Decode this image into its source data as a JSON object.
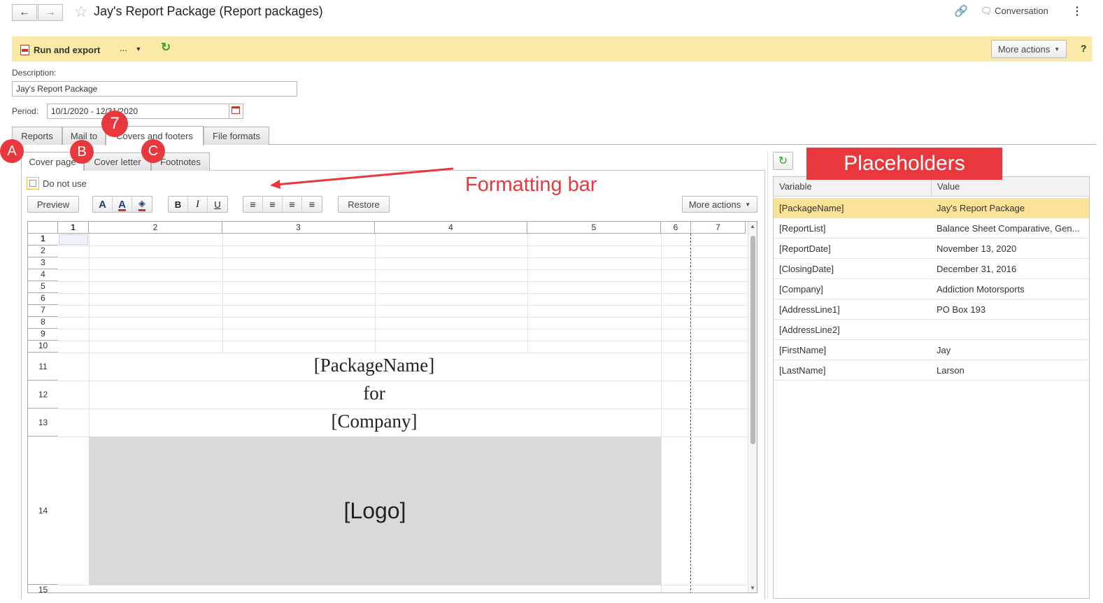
{
  "window": {
    "title": "Jay's Report Package (Report packages)",
    "conversation_label": "Conversation"
  },
  "command_bar": {
    "run_export_label": "Run and export",
    "dots_label": "...",
    "more_actions_label": "More actions",
    "help_label": "?"
  },
  "form": {
    "description_label": "Description:",
    "description_value": "Jay's Report Package",
    "period_label": "Period:",
    "period_value": "10/1/2020 - 12/31/2020"
  },
  "main_tabs": [
    "Reports",
    "Mail to",
    "Covers and footers",
    "File formats"
  ],
  "sub_tabs": [
    "Cover page",
    "Cover letter",
    "Footnotes"
  ],
  "editor": {
    "do_not_use_label": "Do not use",
    "preview_label": "Preview",
    "restore_label": "Restore",
    "more_actions_label": "More actions"
  },
  "sheet": {
    "columns": [
      "1",
      "2",
      "3",
      "4",
      "5",
      "6",
      "7"
    ],
    "rows": [
      "1",
      "2",
      "3",
      "4",
      "5",
      "6",
      "7",
      "8",
      "9",
      "10",
      "11",
      "12",
      "13",
      "14",
      "15"
    ],
    "package_name_text": "[PackageName]",
    "for_text": "for",
    "company_text": "[Company]",
    "logo_text": "[Logo]"
  },
  "placeholders": {
    "col_variable": "Variable",
    "col_value": "Value",
    "rows": [
      {
        "variable": "[PackageName]",
        "value": "Jay's Report Package"
      },
      {
        "variable": "[ReportList]",
        "value": "Balance Sheet Comparative, Gen..."
      },
      {
        "variable": "[ReportDate]",
        "value": "November 13, 2020"
      },
      {
        "variable": "[ClosingDate]",
        "value": "December 31, 2016"
      },
      {
        "variable": "[Company]",
        "value": "Addiction Motorsports"
      },
      {
        "variable": "[AddressLine1]",
        "value": "PO Box 193"
      },
      {
        "variable": "[AddressLine2]",
        "value": ""
      },
      {
        "variable": "[FirstName]",
        "value": "Jay"
      },
      {
        "variable": "[LastName]",
        "value": "Larson"
      }
    ]
  },
  "annotations": {
    "callout_7": "7",
    "callout_a": "A",
    "callout_b": "B",
    "callout_c": "C",
    "formatting_bar": "Formatting bar",
    "placeholders": "Placeholders"
  },
  "colors": {
    "command_bar": "#fbe9a7",
    "selected_row": "#fbe299",
    "annotation": "#e8383d",
    "logo_fill": "#d9d9d9"
  }
}
